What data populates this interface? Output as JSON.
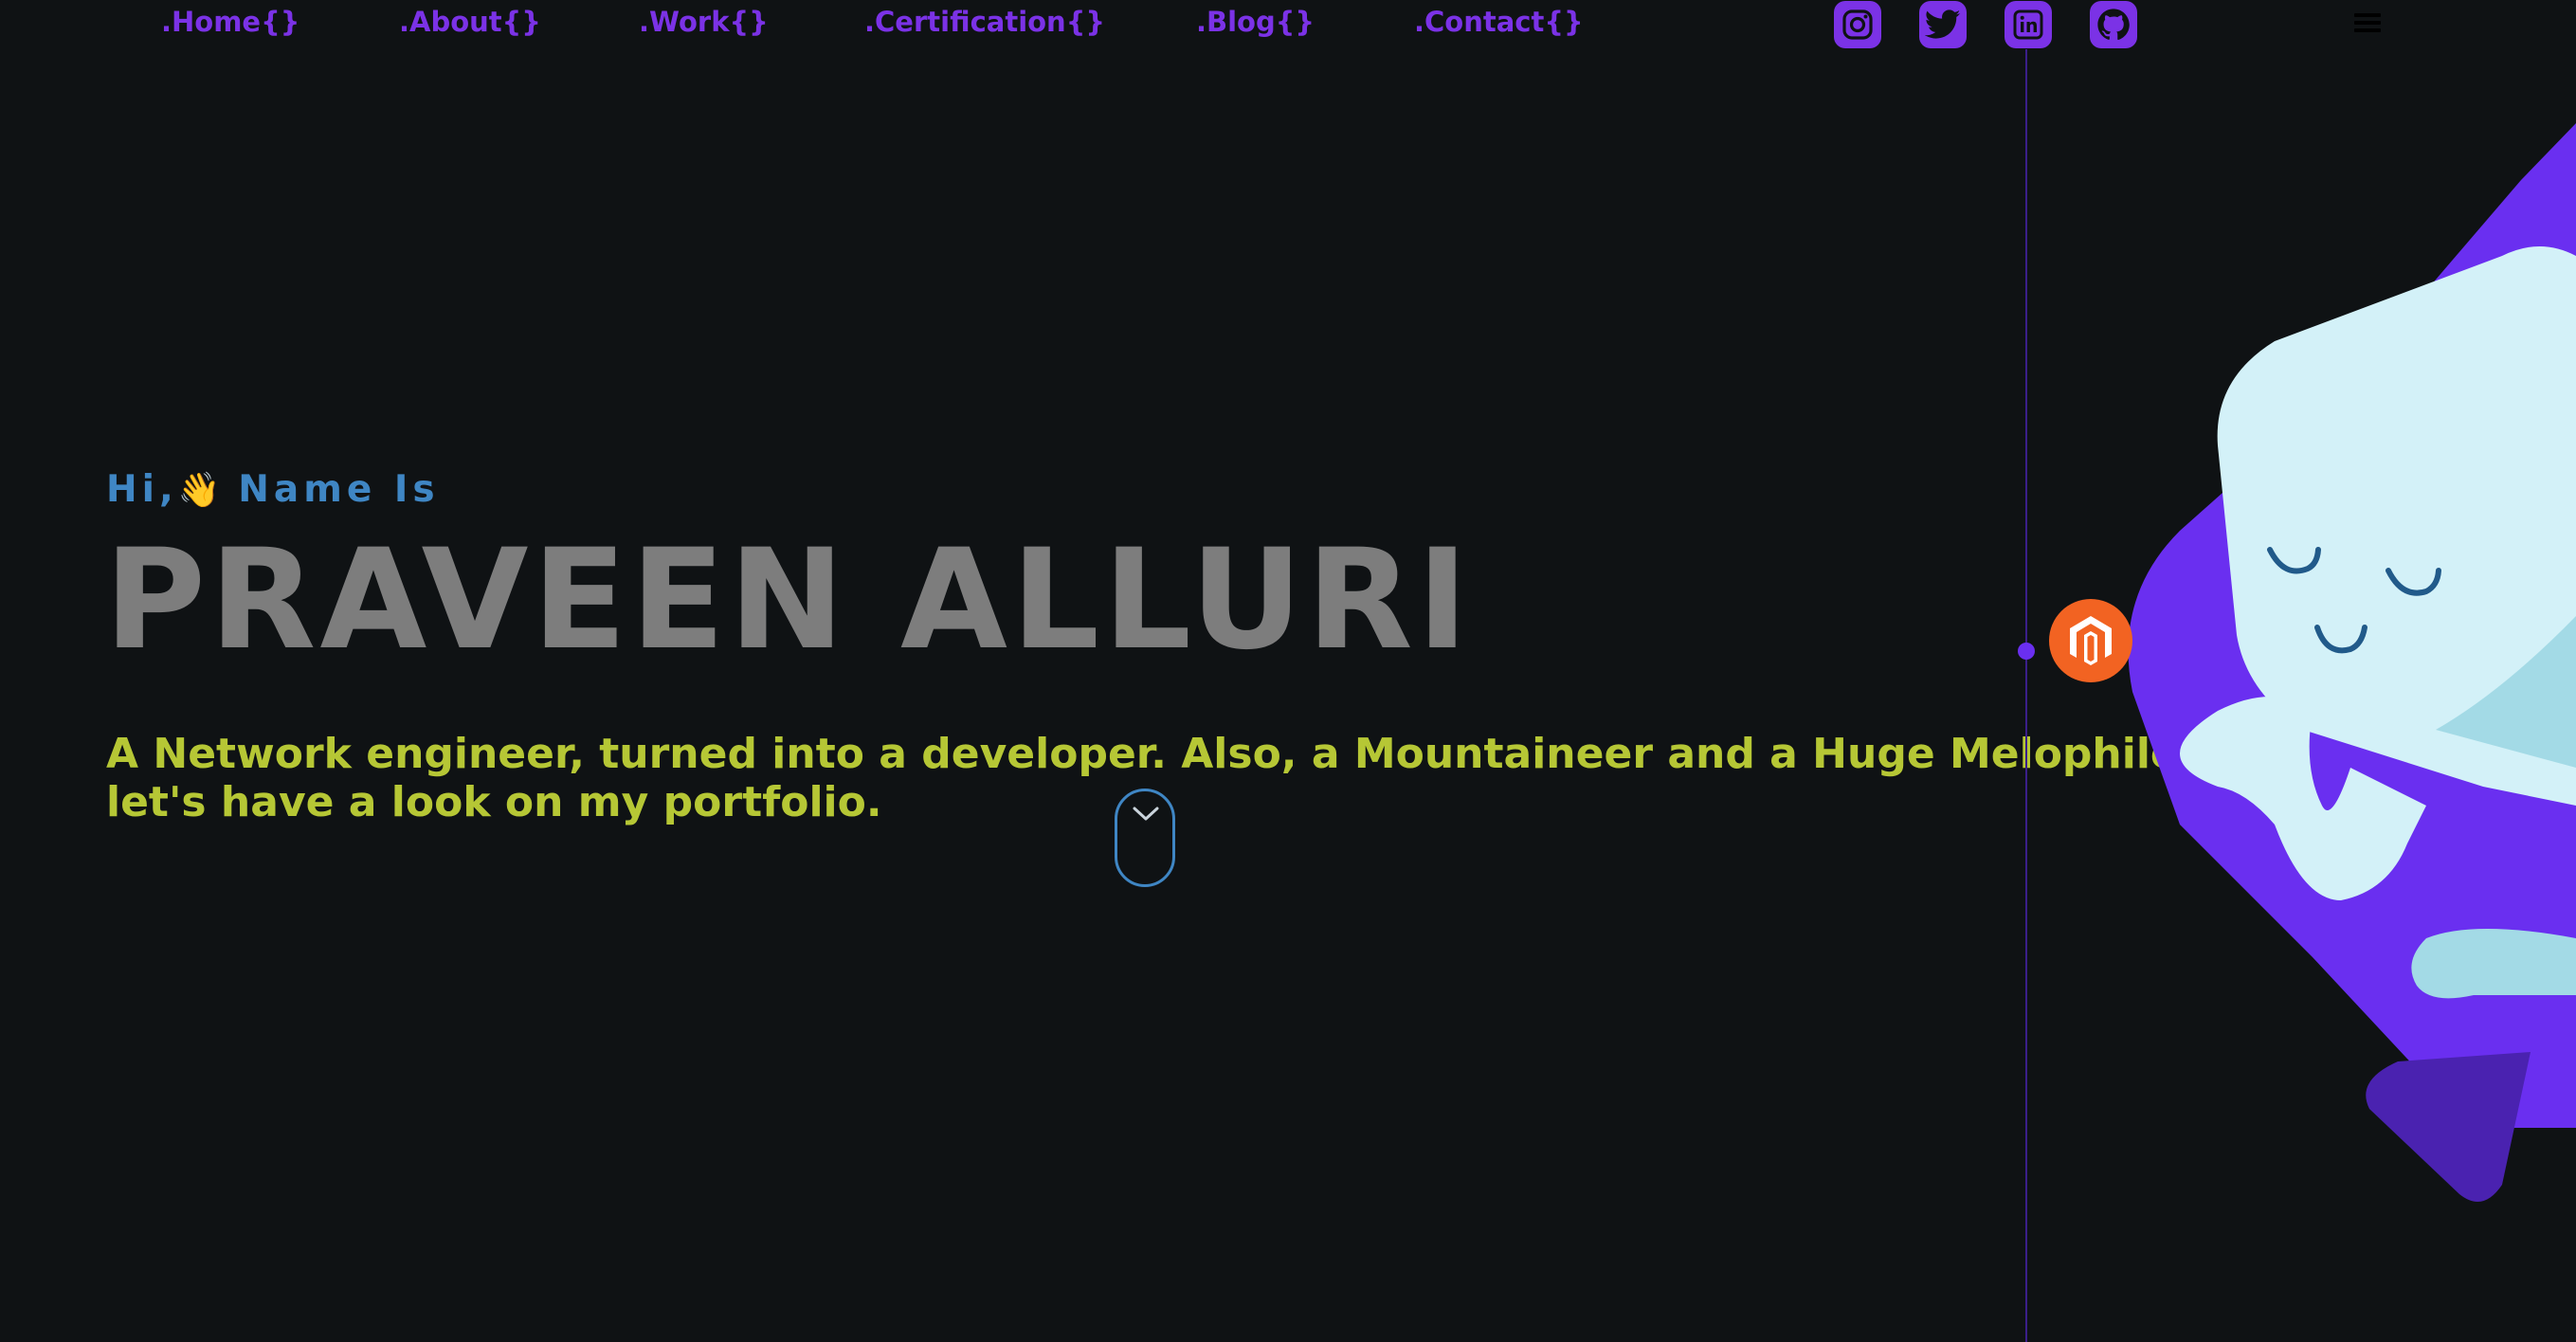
{
  "nav": {
    "links": [
      {
        "label": ".Home{}"
      },
      {
        "label": ".About{}"
      },
      {
        "label": ".Work{}"
      },
      {
        "label": ".Certification{}"
      },
      {
        "label": ".Blog{}"
      },
      {
        "label": ".Contact{}"
      }
    ],
    "social": [
      {
        "icon": "instagram-icon"
      },
      {
        "icon": "twitter-icon"
      },
      {
        "icon": "linkedin-icon"
      },
      {
        "icon": "github-icon"
      }
    ],
    "menu_icon": "hamburger-menu-icon"
  },
  "hero": {
    "greeting_prefix": "Hi,",
    "greeting_emoji": "👋",
    "greeting_suffix": " Name Is",
    "name": "PRAVEEN ALLURI",
    "tagline_line1": "A Network engineer, turned into a developer. Also, a Mountaineer and a Huge Melophile.",
    "tagline_line2": "let's have a look on my portfolio."
  },
  "colors": {
    "background": "#0f1214",
    "nav_accent": "#7b32e6",
    "greeting": "#3f86c4",
    "name": "#7d7d7d",
    "tagline": "#b6c735",
    "badge": "#f26322",
    "mascot_body": "#d3f1f8",
    "mascot_shadow": "#6a2ff0"
  },
  "icons": {
    "scroll": "scroll-down-mouse-icon",
    "badge": "magento-icon",
    "illustration": "sleeping-mascot-illustration"
  }
}
